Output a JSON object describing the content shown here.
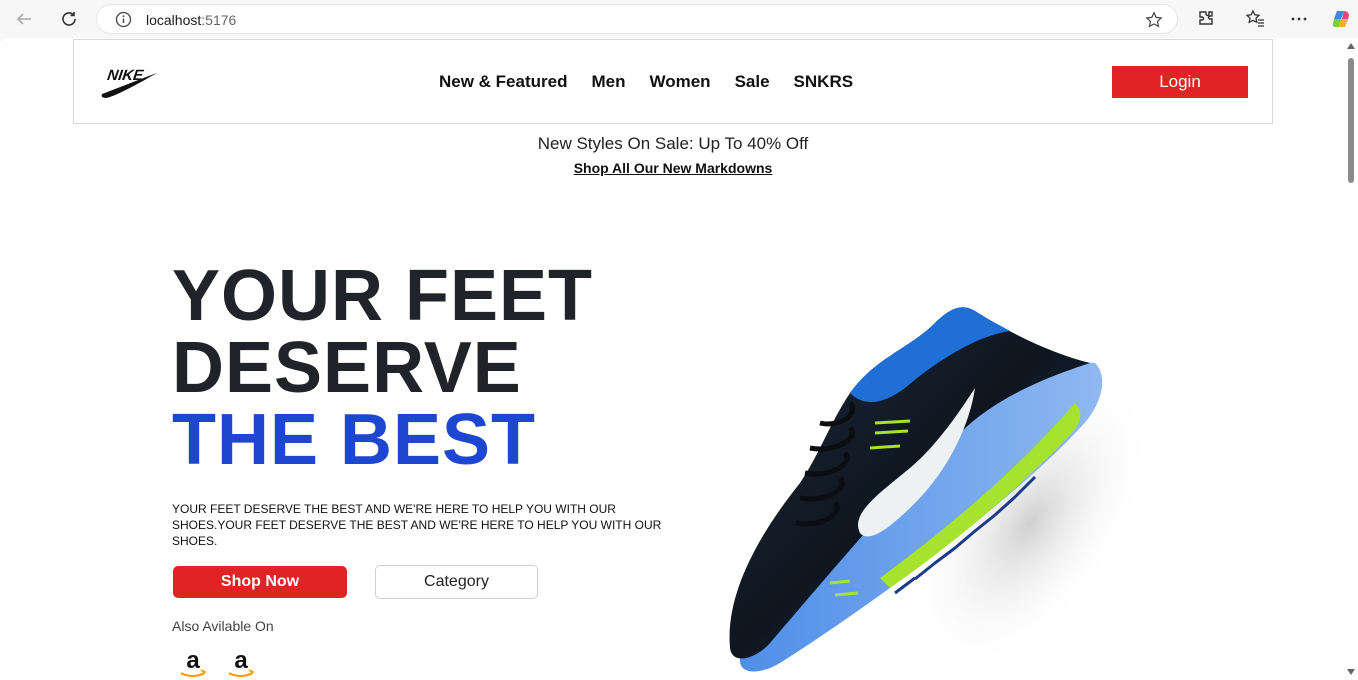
{
  "browser": {
    "url_host": "localhost",
    "url_port": ":5176"
  },
  "header": {
    "logo": "NIKE",
    "nav": [
      "New & Featured",
      "Men",
      "Women",
      "Sale",
      "SNKRS"
    ],
    "login_label": "Login"
  },
  "promo": {
    "text": "New Styles On Sale: Up To 40% Off",
    "link": "Shop All Our New Markdowns"
  },
  "hero": {
    "title_line1": "YOUR FEET",
    "title_line2": "DESERVE",
    "title_line3": "THE BEST",
    "description": "YOUR FEET DESERVE THE BEST AND WE'RE HERE TO HELP YOU WITH OUR SHOES.YOUR FEET DESERVE THE BEST AND WE'RE HERE TO HELP YOU WITH OUR SHOES.",
    "shop_now_label": "Shop Now",
    "category_label": "Category",
    "also_available": "Also Avilable On",
    "stores": [
      "amazon-icon",
      "amazon-icon"
    ]
  },
  "colors": {
    "accent_red": "#e02424",
    "accent_blue": "#1d47d0",
    "text_dark": "#20242a"
  }
}
